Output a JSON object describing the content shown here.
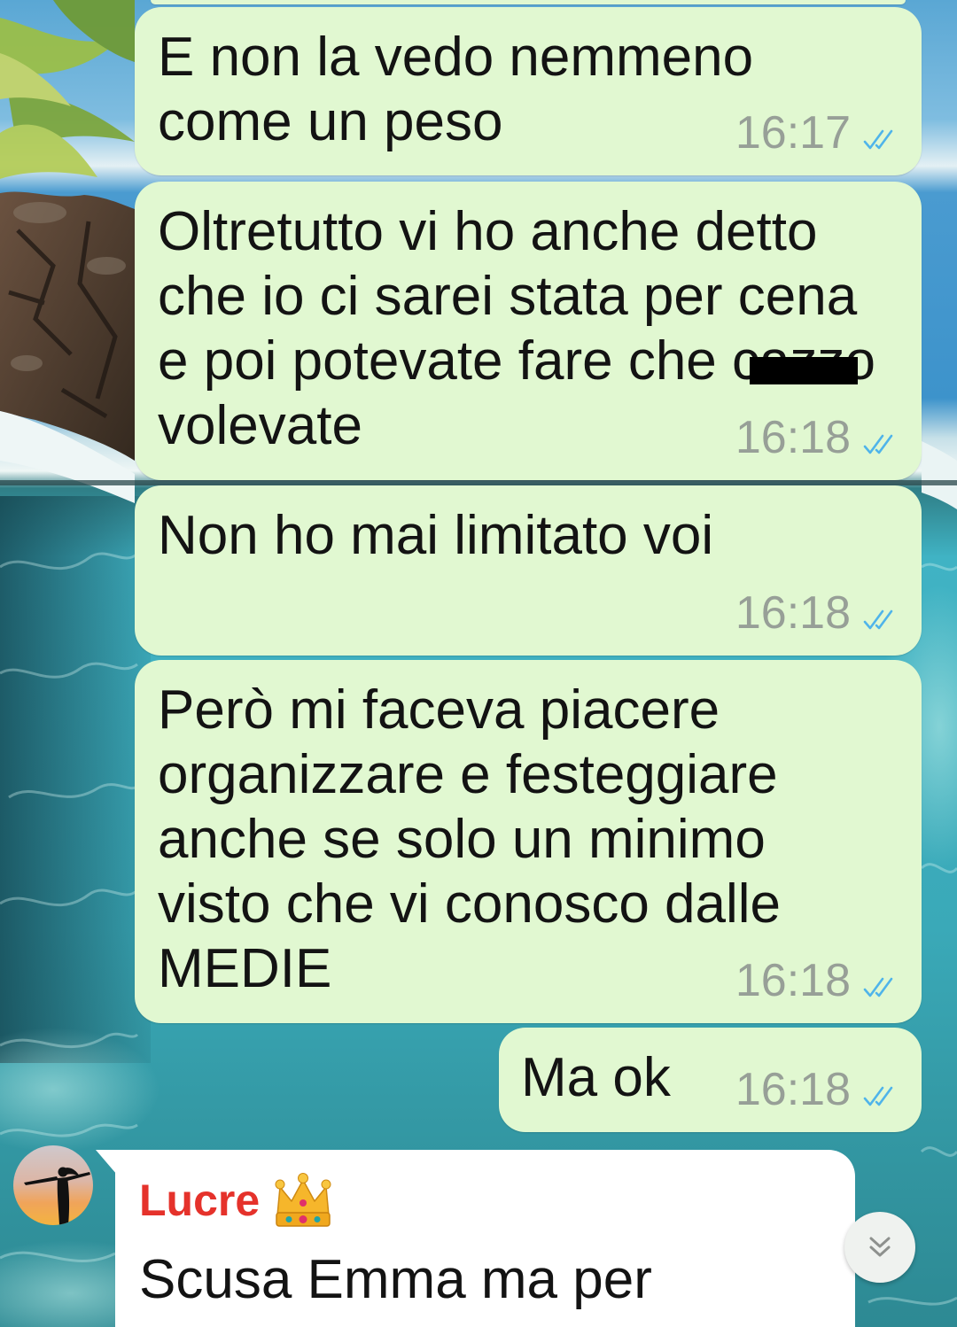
{
  "chat": {
    "messages": [
      {
        "direction": "outgoing",
        "lines": [
          "E non la vedo nemmeno",
          "come un peso"
        ],
        "time": "16:17",
        "status_icon": "double-check-icon"
      },
      {
        "direction": "outgoing",
        "lines": [
          "Oltretutto vi ho anche detto",
          "che io ci sarei stata per cena",
          {
            "text": "e poi potevate fare che ",
            "redacted": "cazzo"
          },
          "volevate"
        ],
        "time": "16:18",
        "status_icon": "double-check-icon"
      },
      {
        "direction": "outgoing",
        "lines": [
          "Non ho mai limitato voi"
        ],
        "time": "16:18",
        "status_icon": "double-check-icon"
      },
      {
        "direction": "outgoing",
        "lines": [
          "Però mi faceva piacere",
          "organizzare e festeggiare",
          "anche se solo un minimo",
          "visto che vi conosco dalle",
          "MEDIE"
        ],
        "time": "16:18",
        "status_icon": "double-check-icon"
      },
      {
        "direction": "outgoing",
        "lines": [
          "Ma ok"
        ],
        "time": "16:18",
        "status_icon": "double-check-icon"
      },
      {
        "direction": "incoming",
        "sender": "Lucre",
        "sender_badge_icon": "crown-icon",
        "avatar_icon": "avatar-silhouette-icon",
        "lines": [
          "Scusa Emma ma per"
        ]
      }
    ],
    "scroll_to_bottom": {
      "icon": "double-chevron-down-icon"
    }
  },
  "colors": {
    "outgoing_bubble": "#e1f8d1",
    "incoming_bubble": "#ffffff",
    "timestamp": "#979f97",
    "read_check": "#4fb4ea",
    "sender_name": "#e5322b"
  }
}
